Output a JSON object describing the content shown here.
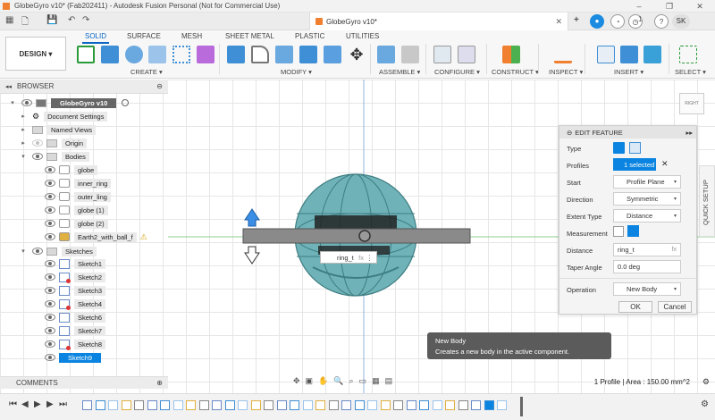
{
  "window": {
    "title": "GlobeGyro v10* (Fab202411) - Autodesk Fusion Personal (Not for Commercial Use)",
    "min": "–",
    "max": "❐",
    "close": "✕"
  },
  "doc_tab": {
    "title": "GlobeGyro v10*",
    "close": "✕"
  },
  "account": {
    "initials": "SK",
    "notifications": "1"
  },
  "ribbon": {
    "workspace": "DESIGN ▾",
    "tabs": [
      "SOLID",
      "SURFACE",
      "MESH",
      "SHEET METAL",
      "PLASTIC",
      "UTILITIES"
    ],
    "groups": [
      "CREATE ▾",
      "MODIFY ▾",
      "ASSEMBLE ▾",
      "CONFIGURE ▾",
      "CONSTRUCT ▾",
      "INSPECT ▾",
      "INSERT ▾",
      "SELECT ▾"
    ]
  },
  "browser": {
    "title": "BROWSER",
    "root": "GlobeGyro v10",
    "items": [
      "Document Settings",
      "Named Views",
      "Origin",
      "Bodies"
    ],
    "bodies": [
      "globe",
      "inner_ring",
      "outer_ling",
      "globe (1)",
      "globe (2)",
      "Earth2_with_ball_f"
    ],
    "sketches_folder": "Sketches",
    "sketches": [
      "Sketch1",
      "Sketch2",
      "Sketch3",
      "Sketch4",
      "Sketch6",
      "Sketch7",
      "Sketch8",
      "Sketch9"
    ]
  },
  "comments": "COMMENTS",
  "viewcube": "RIGHT",
  "canvas_input": {
    "value": "ring_t",
    "fx": "fx"
  },
  "edit_feature": {
    "title": "EDIT FEATURE",
    "rows": [
      {
        "label": "Type"
      },
      {
        "label": "Profiles",
        "value": "1 selected"
      },
      {
        "label": "Start",
        "value": "Profile Plane"
      },
      {
        "label": "Direction",
        "value": "Symmetric"
      },
      {
        "label": "Extent Type",
        "value": "Distance"
      },
      {
        "label": "Measurement"
      },
      {
        "label": "Distance",
        "value": "ring_t"
      },
      {
        "label": "Taper Angle",
        "value": "0.0 deg"
      },
      {
        "label": "Operation",
        "value": "New Body"
      }
    ],
    "ok": "OK",
    "cancel": "Cancel"
  },
  "quick_setup": "QUICK SETUP",
  "tooltip": {
    "title": "New Body",
    "text": "Creates a new body in the active component."
  },
  "status": "1 Profile | Area : 150.00 mm^2",
  "colors": {
    "accent": "#0a84e0",
    "ring": "#8a8a8a",
    "globe": "#6fb3b8"
  }
}
